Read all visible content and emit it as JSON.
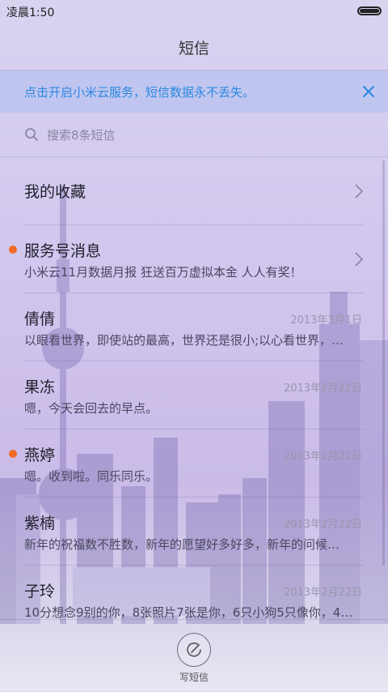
{
  "status_bar": {
    "time": "凌晨1:50"
  },
  "header": {
    "title": "短信"
  },
  "banner": {
    "text": "点击开启小米云服务，短信数据永不丢失。"
  },
  "search": {
    "placeholder": "搜索8条短信"
  },
  "colors": {
    "accent": "#2c88e0",
    "unread": "#f36b26"
  },
  "conversations": [
    {
      "name": "我的收藏",
      "date": "",
      "preview": "",
      "unread": false,
      "chevron": true
    },
    {
      "name": "服务号消息",
      "date": "",
      "preview": "小米云11月数据月报 狂送百万虚拟本金 人人有奖！",
      "unread": true,
      "chevron": true
    },
    {
      "name": "倩倩",
      "date": "2013年3月1日",
      "preview": "以眼看世界，即使站的最高，世界还是很小;以心看世界，…",
      "unread": false,
      "chevron": false
    },
    {
      "name": "果冻",
      "date": "2013年2月22日",
      "preview": "嗯，今天会回去的早点。",
      "unread": false,
      "chevron": false
    },
    {
      "name": "燕婷",
      "date": "2013年2月22日",
      "preview": "嗯。收到啦。同乐同乐。",
      "unread": true,
      "chevron": false
    },
    {
      "name": "紫楠",
      "date": "2013年2月22日",
      "preview": "新年的祝福数不胜数，新年的愿望好多好多，新年的问候…",
      "unread": false,
      "chevron": false
    },
    {
      "name": "子玲",
      "date": "2013年2月22日",
      "preview": "10分想念9别的你，8张照片7张是你，6只小狗5只像你，4…",
      "unread": false,
      "chevron": false
    }
  ],
  "bottom": {
    "compose_label": "写短信"
  }
}
